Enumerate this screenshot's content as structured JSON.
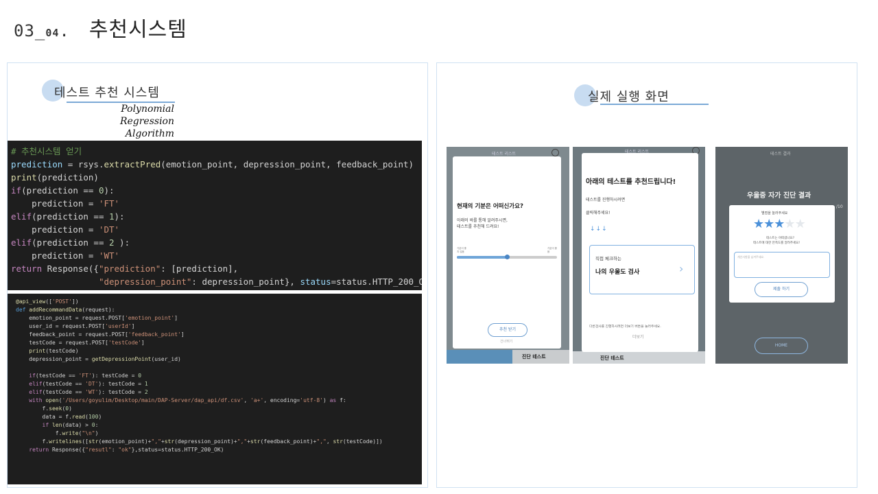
{
  "page": {
    "number_main": "03_",
    "number_sub": "04",
    "number_dot": ".",
    "title": "추천시스템"
  },
  "left_panel": {
    "heading": "테스트 추천 시스템",
    "algorithm_line1": "Polynomial Regression",
    "algorithm_line2": "Algorithm"
  },
  "right_panel": {
    "heading": "실제 실행 화면"
  },
  "code_block_1": [
    [
      [
        "cm",
        "# 추천시스템 얻기"
      ]
    ],
    [
      [
        "va",
        "prediction"
      ],
      [
        "tx",
        " = rsys."
      ],
      [
        "fn",
        "extractPred"
      ],
      [
        "tx",
        "(emotion_point, depression_point, feedback_point)"
      ]
    ],
    [
      [
        "fn",
        "print"
      ],
      [
        "tx",
        "(prediction)"
      ]
    ],
    [
      [
        "kw",
        "if"
      ],
      [
        "tx",
        "(prediction == "
      ],
      [
        "nm",
        "0"
      ],
      [
        "tx",
        "):"
      ]
    ],
    [
      [
        "tx",
        "    prediction = "
      ],
      [
        "st",
        "'FT'"
      ]
    ],
    [
      [
        "kw",
        "elif"
      ],
      [
        "tx",
        "(prediction == "
      ],
      [
        "nm",
        "1"
      ],
      [
        "tx",
        "):"
      ]
    ],
    [
      [
        "tx",
        "    prediction = "
      ],
      [
        "st",
        "'DT'"
      ]
    ],
    [
      [
        "kw",
        "elif"
      ],
      [
        "tx",
        "(prediction == "
      ],
      [
        "nm",
        "2"
      ],
      [
        "tx",
        " ):"
      ]
    ],
    [
      [
        "tx",
        "    prediction = "
      ],
      [
        "st",
        "'WT'"
      ]
    ],
    [
      [
        "kw",
        "return"
      ],
      [
        "tx",
        " Response({"
      ],
      [
        "st",
        "\"prediction\""
      ],
      [
        "tx",
        ": [prediction],"
      ]
    ],
    [
      [
        "tx",
        "                 "
      ],
      [
        "st",
        "\"depression_point\""
      ],
      [
        "tx",
        ": depression_point}, "
      ],
      [
        "va",
        "status"
      ],
      [
        "tx",
        "=status.HTTP_200_OK)"
      ]
    ]
  ],
  "code_block_2": [
    [
      [
        "dc",
        "@api_view"
      ],
      [
        "tx",
        "(["
      ],
      [
        "st",
        "'POST'"
      ],
      [
        "tx",
        "])"
      ]
    ],
    [
      [
        "bl",
        "def "
      ],
      [
        "fn",
        "addRecommandData"
      ],
      [
        "tx",
        "(request):"
      ]
    ],
    [
      [
        "tx",
        "    emotion_point = request.POST["
      ],
      [
        "st",
        "'emotion_point'"
      ],
      [
        "tx",
        "]"
      ]
    ],
    [
      [
        "tx",
        "    user_id = request.POST["
      ],
      [
        "st",
        "'userId'"
      ],
      [
        "tx",
        "]"
      ]
    ],
    [
      [
        "tx",
        "    feedback_point = request.POST["
      ],
      [
        "st",
        "'feedback_point'"
      ],
      [
        "tx",
        "]"
      ]
    ],
    [
      [
        "tx",
        "    testCode = request.POST["
      ],
      [
        "st",
        "'testCode'"
      ],
      [
        "tx",
        "]"
      ]
    ],
    [
      [
        "tx",
        "    "
      ],
      [
        "fn",
        "print"
      ],
      [
        "tx",
        "(testCode)"
      ]
    ],
    [
      [
        "tx",
        "    depression_point = "
      ],
      [
        "fn",
        "getDepressionPoint"
      ],
      [
        "tx",
        "(user_id)"
      ]
    ],
    [
      [
        "tx",
        ""
      ]
    ],
    [
      [
        "tx",
        "    "
      ],
      [
        "kw",
        "if"
      ],
      [
        "tx",
        "(testCode == "
      ],
      [
        "st",
        "'FT'"
      ],
      [
        "tx",
        "): testCode = "
      ],
      [
        "nm",
        "0"
      ]
    ],
    [
      [
        "tx",
        "    "
      ],
      [
        "kw",
        "elif"
      ],
      [
        "tx",
        "(testCode == "
      ],
      [
        "st",
        "'DT'"
      ],
      [
        "tx",
        "): testCode = "
      ],
      [
        "nm",
        "1"
      ]
    ],
    [
      [
        "tx",
        "    "
      ],
      [
        "kw",
        "elif"
      ],
      [
        "tx",
        "(testCode == "
      ],
      [
        "st",
        "'WT'"
      ],
      [
        "tx",
        "): testCode = "
      ],
      [
        "nm",
        "2"
      ]
    ],
    [
      [
        "tx",
        "    "
      ],
      [
        "kw",
        "with "
      ],
      [
        "fn",
        "open"
      ],
      [
        "tx",
        "("
      ],
      [
        "st",
        "'/Users/goyulim/Desktop/main/DAP-Server/dap_api/df.csv'"
      ],
      [
        "tx",
        ", "
      ],
      [
        "st",
        "'a+'"
      ],
      [
        "tx",
        ", encoding="
      ],
      [
        "st",
        "'utf-8'"
      ],
      [
        "tx",
        ") "
      ],
      [
        "kw",
        "as"
      ],
      [
        "tx",
        " f:"
      ]
    ],
    [
      [
        "tx",
        "        f."
      ],
      [
        "fn",
        "seek"
      ],
      [
        "tx",
        "("
      ],
      [
        "nm",
        "0"
      ],
      [
        "tx",
        ")"
      ]
    ],
    [
      [
        "tx",
        "        data = f."
      ],
      [
        "fn",
        "read"
      ],
      [
        "tx",
        "("
      ],
      [
        "nm",
        "100"
      ],
      [
        "tx",
        ")"
      ]
    ],
    [
      [
        "tx",
        "        "
      ],
      [
        "kw",
        "if "
      ],
      [
        "fn",
        "len"
      ],
      [
        "tx",
        "(data) > "
      ],
      [
        "nm",
        "0"
      ],
      [
        "tx",
        ":"
      ]
    ],
    [
      [
        "tx",
        "            f."
      ],
      [
        "fn",
        "write"
      ],
      [
        "tx",
        "("
      ],
      [
        "st",
        "\"\\n\""
      ],
      [
        "tx",
        ")"
      ]
    ],
    [
      [
        "tx",
        "        f."
      ],
      [
        "fn",
        "writelines"
      ],
      [
        "tx",
        "(["
      ],
      [
        "fn",
        "str"
      ],
      [
        "tx",
        "(emotion_point)+"
      ],
      [
        "st",
        "\",\""
      ],
      [
        "tx",
        "+"
      ],
      [
        "fn",
        "str"
      ],
      [
        "tx",
        "(depression_point)+"
      ],
      [
        "st",
        "\",\""
      ],
      [
        "tx",
        "+"
      ],
      [
        "fn",
        "str"
      ],
      [
        "tx",
        "(feedback_point)+"
      ],
      [
        "st",
        "\",\""
      ],
      [
        "tx",
        ", "
      ],
      [
        "fn",
        "str"
      ],
      [
        "tx",
        "(testCode)])"
      ]
    ],
    [
      [
        "tx",
        "    "
      ],
      [
        "kw",
        "return"
      ],
      [
        "tx",
        " Response({"
      ],
      [
        "st",
        "\"resutl\""
      ],
      [
        "tx",
        ": "
      ],
      [
        "st",
        "\"ok\""
      ],
      [
        "tx",
        "},status=status.HTTP_200_OK)"
      ]
    ]
  ],
  "screen1": {
    "header": "테스트 리스트",
    "question": "현재의 기분은 어떠신가요?",
    "desc_line1": "아래의 바를 통해 알려주시면,",
    "desc_line2": "테스트를 추천해 드려요!",
    "slider_left": "기분이 좋지 않음",
    "slider_right": "기분이 좋음",
    "slider_value": 0.5,
    "button": "추천 받기",
    "later": "건너뛰기",
    "footer_right": "진단 테스트"
  },
  "screen2": {
    "header": "테스트 리스트",
    "title": "아래의 테스트를 추천드립니다!",
    "line1": "테스트를 진행하시려면",
    "line2": "클릭해주세요!",
    "arrows": "↓↓↓",
    "card_sub": "직접 체크하는",
    "card_title": "나의 우울도 검사",
    "card_chevron": "›",
    "note": "다른검사를 진행하시려면 더보기 버튼을 눌러주세요.",
    "more": "더보기",
    "footer": "진단 테스트"
  },
  "screen3": {
    "header": "테스트 결과",
    "result_title": "우울증 자가 진단 결과",
    "side_note": "/10",
    "prompt": "별점을 눌러주세요",
    "stars_filled": 3,
    "stars_total": 5,
    "feedback_q1": "테스트는 어떠셨나요?",
    "feedback_q2": "테스트에 대한 만족도를 알려주세요!",
    "textarea_placeholder": "개선사항을 남겨주세요.",
    "submit": "제출 하기",
    "home": "HOME",
    "accent": "#4a90d9"
  }
}
